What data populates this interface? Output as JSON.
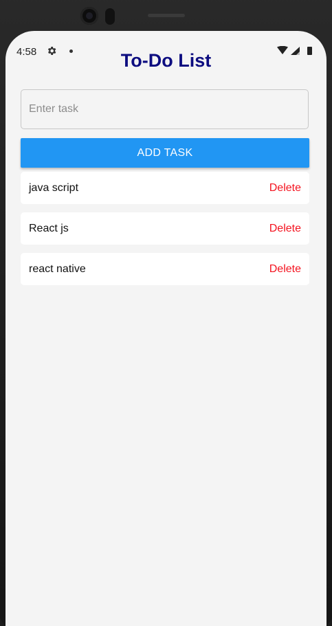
{
  "status_bar": {
    "time": "4:58",
    "icons": [
      "gear-icon",
      "notification-dot",
      "wifi-icon",
      "signal-icon",
      "battery-icon"
    ]
  },
  "app": {
    "title": "To-Do List",
    "input": {
      "placeholder": "Enter task",
      "value": ""
    },
    "add_button_label": "ADD TASK",
    "tasks": [
      {
        "text": "java script",
        "delete_label": "Delete"
      },
      {
        "text": "React js",
        "delete_label": "Delete"
      },
      {
        "text": "react native",
        "delete_label": "Delete"
      }
    ]
  },
  "colors": {
    "title": "#0d0d80",
    "button": "#2196f3",
    "delete": "#f4121e",
    "background": "#f4f4f4"
  }
}
